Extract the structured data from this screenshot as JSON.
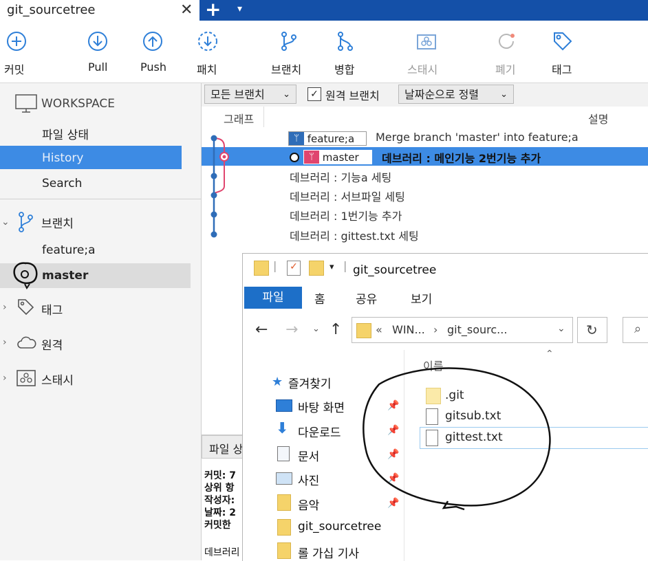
{
  "tab": {
    "title": "git_sourcetree",
    "close_glyph": "✕",
    "plus_glyph": "+",
    "caret_glyph": "▾"
  },
  "toolbar": {
    "commit": "커밋",
    "pull": "Pull",
    "push": "Push",
    "fetch": "패치",
    "branch": "브랜치",
    "merge": "병합",
    "stash": "스태시",
    "discard": "폐기",
    "tag": "태그"
  },
  "sidebar": {
    "workspace": "WORKSPACE",
    "file_status": "파일 상태",
    "history": "History",
    "search": "Search",
    "branches_header": "브랜치",
    "branches": [
      "feature;a",
      "master"
    ],
    "tags_header": "태그",
    "remotes_header": "원격",
    "stashes_header": "스태시"
  },
  "filterbar": {
    "all_branches": "모든 브랜치",
    "remote_branches": "원격 브랜치",
    "sort": "날짜순으로 정렬",
    "remote_checked": true
  },
  "columns": {
    "graph": "그래프",
    "description": "설명"
  },
  "commits": [
    {
      "badge": "feature;a",
      "message": "Merge branch 'master' into feature;a"
    },
    {
      "badge": "master",
      "message": "데브러리 : 메인기능 2번기능 추가"
    },
    {
      "message": "데브러리 : 기능a 세팅"
    },
    {
      "message": "데브러리 : 서브파일 세팅"
    },
    {
      "message": "데브러리 : 1번기능 추가"
    },
    {
      "message": "데브러리 : gittest.txt 세팅"
    }
  ],
  "details": {
    "tab": "파일 상",
    "lines": [
      "커밋: 7",
      "상위 항",
      "작성자:",
      "날짜: 2",
      "커밋한 ",
      "",
      "데브러리"
    ]
  },
  "explorer": {
    "title": "git_sourcetree",
    "ribbon": [
      "파일",
      "홈",
      "공유",
      "보기"
    ],
    "address_prefix": "«",
    "address_parts": [
      "WIN...",
      "git_sourc..."
    ],
    "column_name": "이름",
    "nav": [
      {
        "label": "즐겨찾기",
        "icon": "star-icon"
      },
      {
        "label": "바탕 화면",
        "icon": "desktop-icon"
      },
      {
        "label": "다운로드",
        "icon": "download-icon"
      },
      {
        "label": "문서",
        "icon": "document-icon"
      },
      {
        "label": "사진",
        "icon": "picture-icon"
      },
      {
        "label": "음악",
        "icon": "folder-icon"
      },
      {
        "label": "git_sourcetree",
        "icon": "folder-icon"
      },
      {
        "label": "롤 가십 기사",
        "icon": "folder-icon"
      }
    ],
    "files": [
      ".git",
      "gitsub.txt",
      "gittest.txt"
    ]
  },
  "colors": {
    "accent": "#3d8be4",
    "tabbar": "#1450a8",
    "graph_blue": "#2f6db8",
    "graph_pink": "#e0456e"
  }
}
